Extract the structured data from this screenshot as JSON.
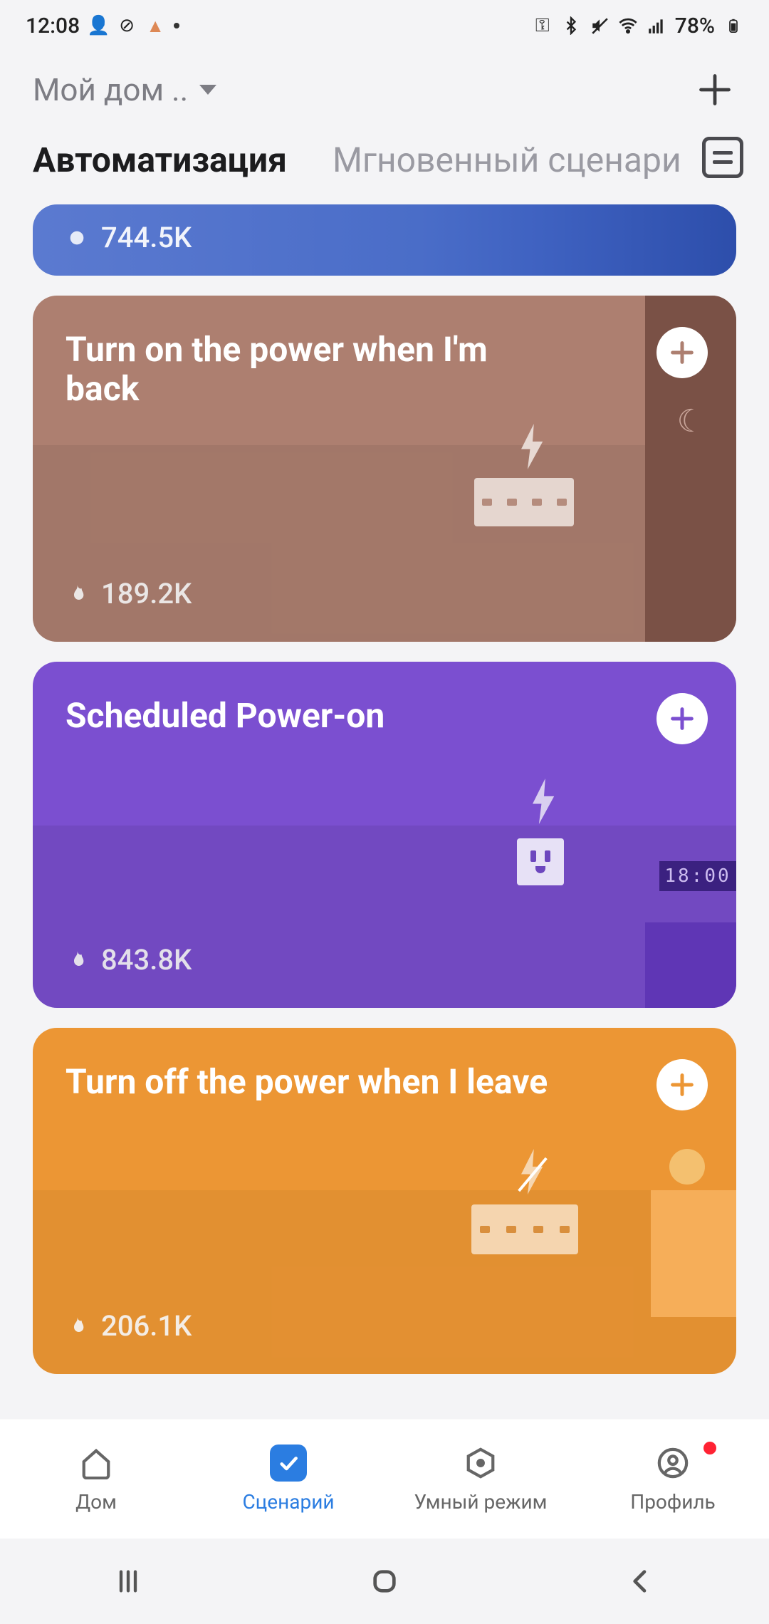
{
  "status": {
    "time": "12:08",
    "battery": "78%"
  },
  "header": {
    "home_label": "Мой дом .."
  },
  "tabs": {
    "automation": "Автоматизация",
    "instant": "Мгновенный сценари"
  },
  "cards": [
    {
      "stat": "744.5K"
    },
    {
      "title": "Turn on the power when I'm back",
      "stat": "189.2K"
    },
    {
      "title": "Scheduled Power-on",
      "stat": "843.8K",
      "clock": "18:00"
    },
    {
      "title": "Turn off the power when I leave",
      "stat": "206.1K"
    }
  ],
  "bottom_nav": {
    "home": "Дом",
    "scenario": "Сценарий",
    "smart": "Умный режим",
    "profile": "Профиль"
  }
}
